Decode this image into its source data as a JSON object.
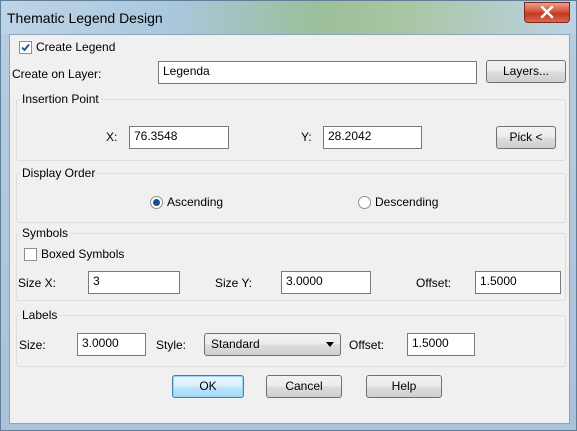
{
  "window": {
    "title": "Thematic Legend Design"
  },
  "create_legend": {
    "label": "Create Legend",
    "checked": true
  },
  "layer": {
    "label": "Create on Layer:",
    "value": "Legenda",
    "button": "Layers..."
  },
  "insertion": {
    "title": "Insertion Point",
    "x_label": "X:",
    "x_value": "76.3548",
    "y_label": "Y:",
    "y_value": "28.2042",
    "pick_button": "Pick <"
  },
  "display_order": {
    "title": "Display Order",
    "ascending": "Ascending",
    "descending": "Descending",
    "selected": "Ascending"
  },
  "symbols": {
    "title": "Symbols",
    "boxed_label": "Boxed Symbols",
    "boxed_checked": false,
    "size_x_label": "Size X:",
    "size_x_value": "3",
    "size_y_label": "Size Y:",
    "size_y_value": "3.0000",
    "offset_label": "Offset:",
    "offset_value": "1.5000"
  },
  "labels": {
    "title": "Labels",
    "size_label": "Size:",
    "size_value": "3.0000",
    "style_label": "Style:",
    "style_value": "Standard",
    "offset_label": "Offset:",
    "offset_value": "1.5000"
  },
  "buttons": {
    "ok": "OK",
    "cancel": "Cancel",
    "help": "Help"
  },
  "colors": {
    "accent": "#3c7fb1",
    "close": "#c2381f",
    "dialog_bg": "#f0f0f0"
  }
}
